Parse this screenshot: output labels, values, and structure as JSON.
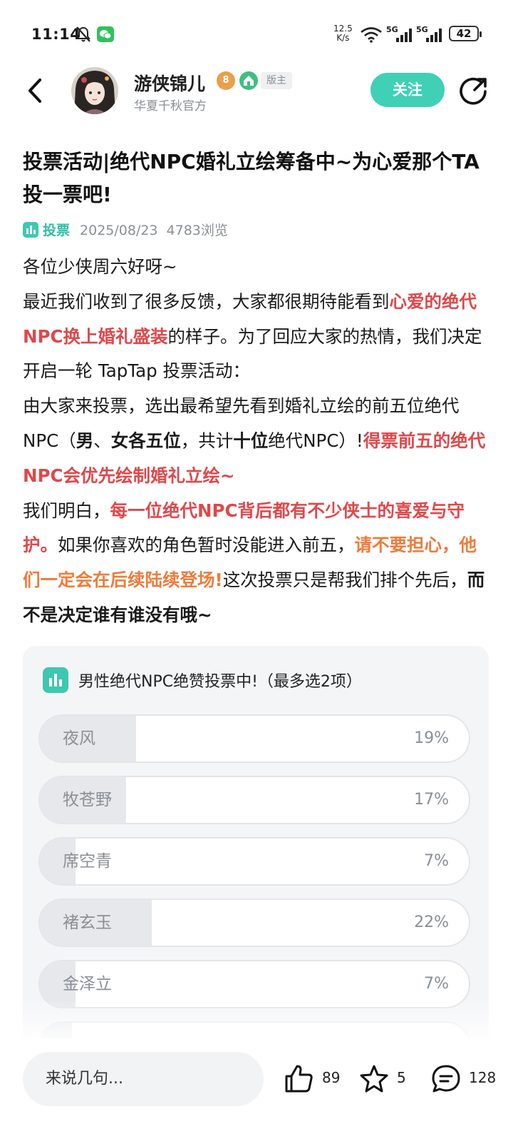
{
  "status_bar": {
    "time": "11:14",
    "net_speed_value": "12.5",
    "net_speed_unit": "K/s",
    "signal1": "5G",
    "signal2": "5G",
    "battery": "42"
  },
  "header": {
    "author_name": "游侠锦儿",
    "level_badge": "8",
    "moderator_badge": "版主",
    "author_subtitle": "华夏千秋官方",
    "follow_label": "关注"
  },
  "post": {
    "title": "投票活动|绝代NPC婚礼立绘筹备中~为心爱那个TA投一票吧!",
    "type_label": "投票",
    "date": "2025/08/23",
    "views": "4783浏览",
    "p1": "各位少侠周六好呀~",
    "p2_a": "最近我们收到了很多反馈，大家都很期待能看到",
    "p2_b": "心爱的绝代NPC换上婚礼盛装",
    "p2_c": "的样子。为了回应大家的热情，我们决定开启一轮 TapTap 投票活动：",
    "p3_a": "由大家来投票，选出最希望先看到婚礼立绘的前五位绝代NPC（",
    "p3_b": "男",
    "p3_c": "、",
    "p3_d": "女各五位",
    "p3_e": "，共计",
    "p3_f": "十位",
    "p3_g": "绝代NPC）!",
    "p3_h": "得票前五的绝代NPC会优先绘制婚礼立绘~",
    "p4_a": "我们明白，",
    "p4_b": "每一位绝代NPC背后都有不少侠士的喜爱与守护。",
    "p4_c": "如果你喜欢的角色暂时没能进入前五，",
    "p4_d": "请不要担心，他们一定会在后续陆续登场!",
    "p4_e": "这次投票只是帮我们排个先后，",
    "p4_f": "而不是决定谁有谁没有哦~"
  },
  "poll": {
    "title": "男性绝代NPC绝赞投票中!（最多选2项）",
    "options": [
      {
        "name": "夜风",
        "percent": "19%",
        "value": 19
      },
      {
        "name": "牧苍野",
        "percent": "17%",
        "value": 17
      },
      {
        "name": "席空青",
        "percent": "7%",
        "value": 7
      },
      {
        "name": "褚玄玉",
        "percent": "22%",
        "value": 22
      },
      {
        "name": "金泽立",
        "percent": "7%",
        "value": 7
      }
    ]
  },
  "bottom_bar": {
    "comment_placeholder": "来说几句...",
    "likes": "89",
    "favorites": "5",
    "comments": "128"
  },
  "colors": {
    "accent_teal": "#3fd0b6",
    "highlight_red": "#e0474a",
    "highlight_orange": "#f07a3a"
  }
}
